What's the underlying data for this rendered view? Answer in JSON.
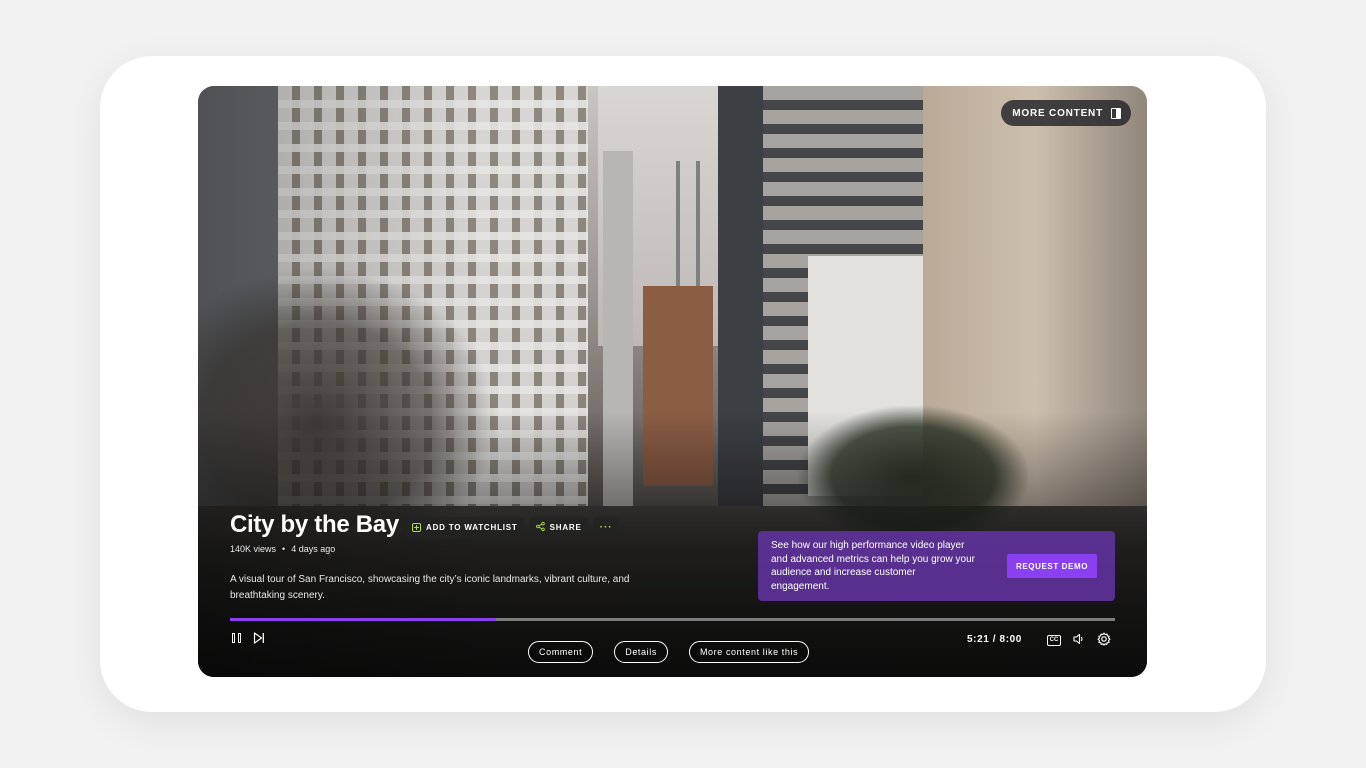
{
  "header": {
    "more_content_label": "MORE CONTENT"
  },
  "video": {
    "title": "City by the Bay",
    "views": "140K views",
    "age": "4 days ago",
    "description": "A visual tour of San Francisco, showcasing the city’s iconic landmarks, vibrant culture, and breathtaking scenery.",
    "progress_fraction": 0.3
  },
  "actions": {
    "watchlist_label": "ADD TO WATCHLIST",
    "share_label": "SHARE",
    "more_label": "···"
  },
  "promo": {
    "text": "See how our high performance video player and advanced metrics can help you grow your audience and increase customer engagement.",
    "button_label": "REQUEST DEMO"
  },
  "chips": {
    "comment": "Comment",
    "details": "Details",
    "more_like_this": "More content like this"
  },
  "player": {
    "time": "5:21 / 8:00",
    "cc_label": "CC"
  },
  "colors": {
    "accent": "#8a3ff0",
    "icon_accent": "#a8e04a",
    "promo_bg": "#6734aa"
  },
  "icons": [
    "panel-icon",
    "plus-icon",
    "share-icon",
    "pause-icon",
    "next-icon",
    "cc-icon",
    "volume-icon",
    "gear-icon"
  ]
}
